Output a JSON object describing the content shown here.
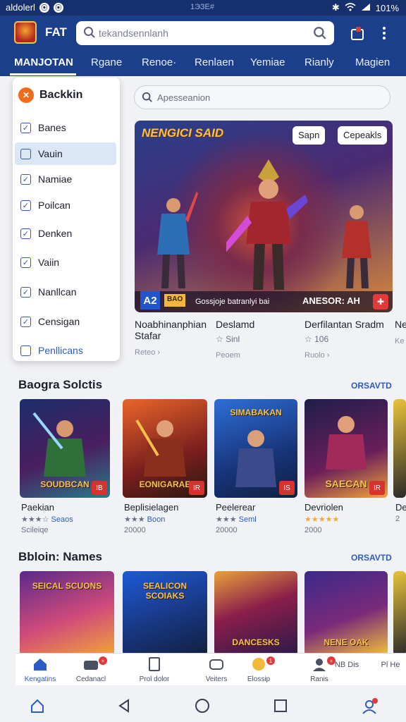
{
  "status_bar": {
    "carrier": "aldolerl",
    "center": "1ЭЗЕ#",
    "battery": "101%"
  },
  "app_bar": {
    "brand": "FAT",
    "search_placeholder": "tekandsennlanh"
  },
  "category_tabs": [
    "MANJOTAN",
    "Rgane",
    "Renoe·",
    "Renlaen",
    "Yemiae",
    "Rianly",
    "Magien"
  ],
  "dropdown": {
    "header": "Backkin",
    "items": [
      {
        "label": "Banes",
        "checked": true,
        "selected": false
      },
      {
        "label": "Vauin",
        "checked": false,
        "selected": true
      },
      {
        "label": "Namiae",
        "checked": true,
        "selected": false
      },
      {
        "label": "Poilcan",
        "checked": true,
        "selected": false
      },
      {
        "label": "Denken",
        "checked": true,
        "selected": false
      },
      {
        "label": "Vaiin",
        "checked": true,
        "selected": false
      },
      {
        "label": "Nanllcan",
        "checked": true,
        "selected": false
      },
      {
        "label": "Censigan",
        "checked": true,
        "selected": false
      },
      {
        "label": "Penllicans",
        "checked": false,
        "selected": false
      }
    ]
  },
  "main_search": {
    "placeholder": "Apesseanion"
  },
  "hero": {
    "title": "NENGICI SAID",
    "chip_1": "Sapn",
    "chip_2": "Cepeakls",
    "badge_a": "A2",
    "badge_b": "BAO",
    "footer_text": "Gossjoje batranlyi bai",
    "footer_right": "ANESOR: AH"
  },
  "hero_info": [
    {
      "title": "Noabhinanphian Stafar",
      "sub": "",
      "meta": "Reteo ›"
    },
    {
      "title": "Deslamd",
      "sub": "Sinl",
      "meta": "Peoem"
    },
    {
      "title": "Derfilantan Sradm",
      "sub": "106",
      "meta": "Ruolo ›"
    },
    {
      "title": "Ne",
      "sub": "",
      "meta": "Ke"
    }
  ],
  "section_1": {
    "title": "Baogra Solctis",
    "link": "ORSAVTD",
    "cards": [
      {
        "art_title": "SOUDBCAN",
        "badge": "IB",
        "name": "Paekian",
        "rating": "Seaos",
        "price": "Scileiqe"
      },
      {
        "art_title": "EONIGARAE",
        "badge": "IR",
        "name": "Beplisielagen",
        "rating": "Boon",
        "price": "20000"
      },
      {
        "art_title": "SIMABAKAN",
        "badge": "IS",
        "name": "Peelerear",
        "rating": "Seml",
        "price": "20000"
      },
      {
        "art_title": "SAECAN",
        "badge": "IR",
        "name": "Devriolen",
        "rating": "",
        "price": "2000"
      },
      {
        "art_title": "",
        "badge": "",
        "name": "De",
        "rating": "",
        "price": "2"
      }
    ]
  },
  "section_2": {
    "title": "Bbloin: Names",
    "link": "ORSAVTD",
    "cards": [
      {
        "art_title": "SEICAL SCUONS"
      },
      {
        "art_title": "SEALICON SCOIAKS"
      },
      {
        "art_title": "DANCESKS"
      },
      {
        "art_title": "NENE OAK"
      }
    ]
  },
  "tab_bar": [
    {
      "label": "Kengatins",
      "badge": ""
    },
    {
      "label": "Cedanacl",
      "badge": "+"
    },
    {
      "label": "Prol dolor",
      "badge": ""
    },
    {
      "label": "Veiters",
      "badge": ""
    },
    {
      "label": "Elossip",
      "badge": "1"
    },
    {
      "label": "Ranis",
      "badge": "+"
    },
    {
      "label": "NB Dis",
      "badge": ""
    },
    {
      "label": "Pl He",
      "badge": ""
    }
  ],
  "colors": {
    "header": "#1c3f8c",
    "accent": "#2d5bc4",
    "badge_red": "#d6332f"
  }
}
